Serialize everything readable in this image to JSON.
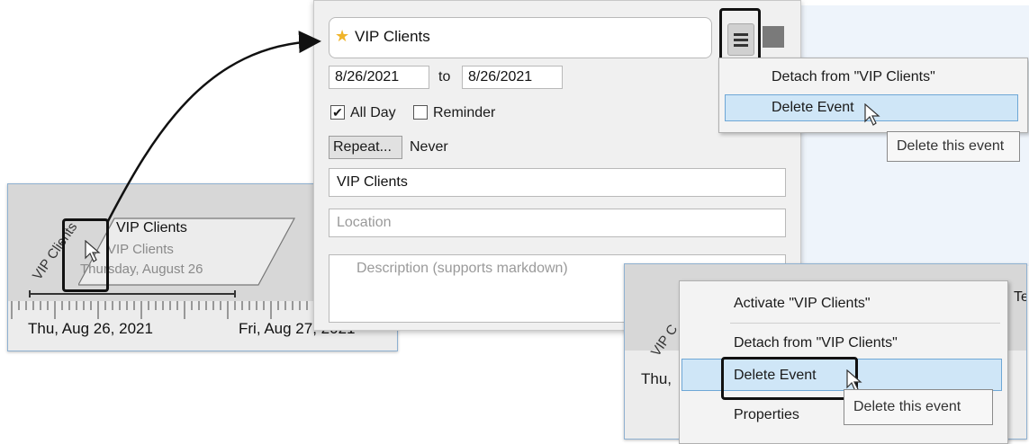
{
  "timeline": {
    "event_title": "VIP Clients",
    "event_subtitle": "VIP Clients",
    "event_date": "Thursday, August 26",
    "rotated_label": "VIP Clients",
    "date_labels": [
      "Thu, Aug 26, 2021",
      "Fri, Aug 27, 2021"
    ]
  },
  "editor": {
    "title": "VIP Clients",
    "title_icon": "star-icon",
    "menu_icon": "hamburger-menu-icon",
    "date_from": "8/26/2021",
    "to_label": "to",
    "date_to": "8/26/2021",
    "all_day_label": "All Day",
    "all_day_checked": true,
    "reminder_label": "Reminder",
    "reminder_checked": false,
    "repeat_button": "Repeat...",
    "repeat_value": "Never",
    "name_value": "VIP Clients",
    "location_placeholder": "Location",
    "description_placeholder": "Description (supports markdown)"
  },
  "editor_menu": {
    "items": [
      "Detach from \"VIP Clients\"",
      "Delete Event"
    ],
    "highlighted": "Delete Event",
    "tooltip": "Delete this event"
  },
  "context_menu": {
    "timeline_date": "Thu,",
    "timeline_rotated": "VIP C",
    "edge_text": "Te",
    "items": [
      "Activate \"VIP Clients\"",
      "Detach from \"VIP Clients\"",
      "Delete Event",
      "Properties"
    ],
    "highlighted": "Delete Event",
    "tooltip": "Delete this event"
  },
  "colors": {
    "highlight": "#cfe6f7",
    "highlight_border": "#6ea7d6",
    "star": "#f0b429",
    "panel_border": "#8fb1d1"
  }
}
